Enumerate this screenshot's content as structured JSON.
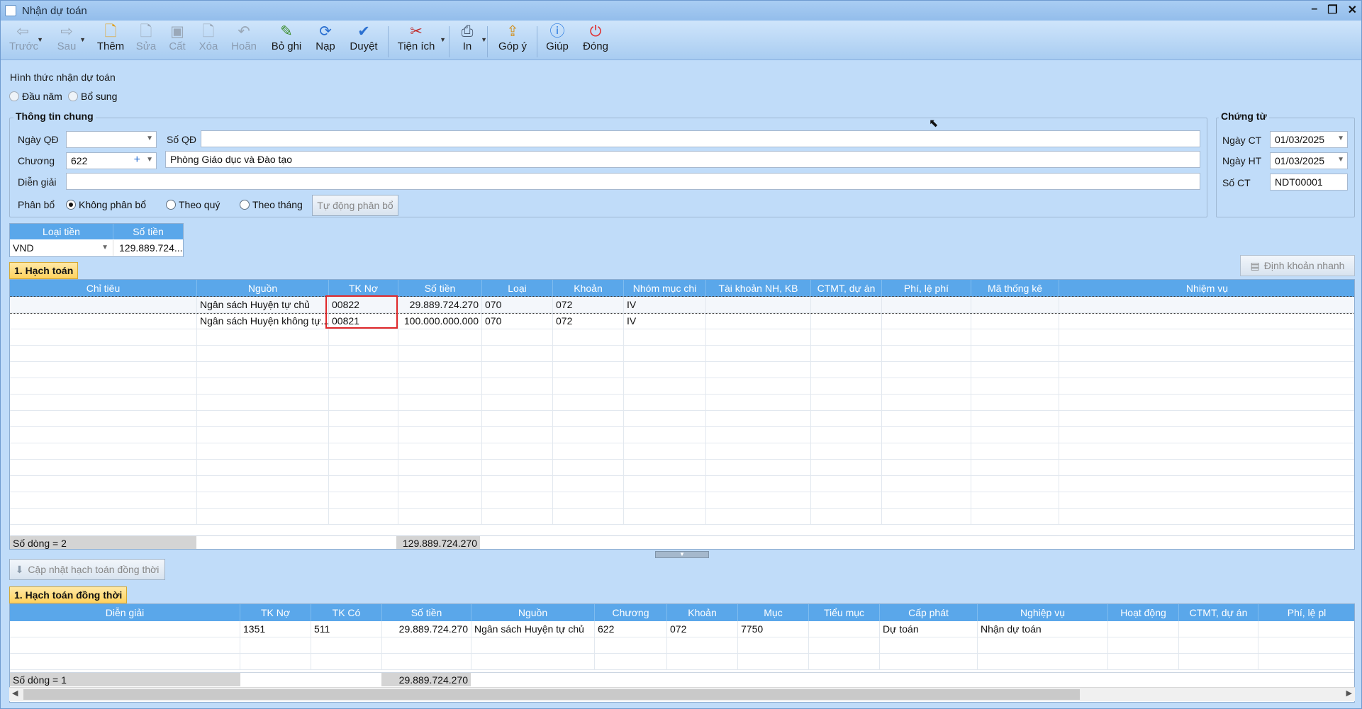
{
  "window": {
    "title": "Nhận dự toán"
  },
  "toolbar": {
    "prev": "Trước",
    "next": "Sau",
    "add": "Thêm",
    "edit": "Sửa",
    "save": "Cất",
    "delete": "Xóa",
    "undo": "Hoãn",
    "unpost": "Bỏ ghi",
    "reload": "Nạp",
    "approve": "Duyệt",
    "utilities": "Tiện ích",
    "print": "In",
    "feedback": "Góp ý",
    "help": "Giúp",
    "close": "Đóng"
  },
  "form": {
    "receive_type_label": "Hình thức nhận dự toán",
    "opt_start_year": "Đầu năm",
    "opt_supplement": "Bổ sung",
    "general_info": "Thông tin chung",
    "decision_date_label": "Ngày QĐ",
    "decision_date_value": "",
    "decision_no_label": "Số QĐ",
    "decision_no_value": "",
    "chapter_label": "Chương",
    "chapter_value": "622",
    "chapter_name": "Phòng Giáo dục và Đào tạo",
    "description_label": "Diễn giải",
    "description_value": "",
    "allocation_label": "Phân bổ",
    "alloc_none": "Không phân bổ",
    "alloc_quarter": "Theo quý",
    "alloc_month": "Theo tháng",
    "auto_allocate": "Tự động phân bổ"
  },
  "voucher": {
    "title": "Chứng từ",
    "doc_date_label": "Ngày CT",
    "doc_date": "01/03/2025",
    "post_date_label": "Ngày HT",
    "post_date": "01/03/2025",
    "doc_no_label": "Số CT",
    "doc_no": "NDT00001"
  },
  "currency": {
    "col_type": "Loại tiền",
    "col_amount": "Số tiền",
    "type": "VND",
    "amount": "129.889.724..."
  },
  "accounting": {
    "tab": "1. Hạch toán",
    "quick_entry": "Định khoản nhanh",
    "columns": [
      "Chỉ tiêu",
      "Nguồn",
      "TK Nợ",
      "Số tiền",
      "Loại",
      "Khoản",
      "Nhóm mục chi",
      "Tài khoản NH, KB",
      "CTMT, dự án",
      "Phí, lệ phí",
      "Mã thống kê",
      "Nhiệm vụ"
    ],
    "rows": [
      [
        "",
        "Ngân sách Huyện tự chủ",
        "00822",
        "29.889.724.270",
        "070",
        "072",
        "IV",
        "",
        "",
        "",
        "",
        ""
      ],
      [
        "",
        "Ngân sách Huyện không tự...",
        "00821",
        "100.000.000.000",
        "070",
        "072",
        "IV",
        "",
        "",
        "",
        "",
        ""
      ]
    ],
    "row_count": "Số dòng = 2",
    "total": "129.889.724.270"
  },
  "update_concurrent": "Cập nhật hạch toán đồng thời",
  "concurrent": {
    "tab": "1. Hạch toán đồng thời",
    "columns": [
      "Diễn giải",
      "TK Nợ",
      "TK Có",
      "Số tiền",
      "Nguồn",
      "Chương",
      "Khoản",
      "Mục",
      "Tiểu mục",
      "Cấp phát",
      "Nghiệp vụ",
      "Hoạt động",
      "CTMT, dự án",
      "Phí, lệ pl"
    ],
    "rows": [
      [
        "",
        "1351",
        "511",
        "29.889.724.270",
        "Ngân sách Huyện tự chủ",
        "622",
        "072",
        "7750",
        "",
        "Dự toán",
        "Nhận dự toán",
        "",
        "",
        ""
      ]
    ],
    "row_count": "Số dòng = 1",
    "total": "29.889.724.270"
  }
}
